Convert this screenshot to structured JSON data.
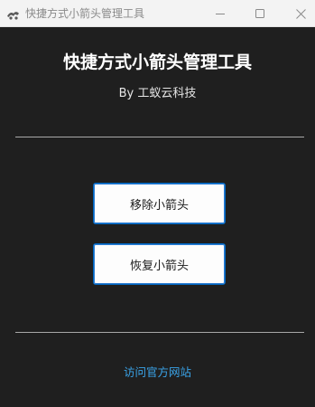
{
  "window": {
    "title": "快捷方式小箭头管理工具"
  },
  "main": {
    "heading": "快捷方式小箭头管理工具",
    "byline": "By 工蚁云科技",
    "remove_button": "移除小箭头",
    "restore_button": "恢复小箭头",
    "website_link": "访问官方网站"
  },
  "colors": {
    "background": "#1f1f1f",
    "titlebar": "#f3f3f3",
    "button_border": "#0067c0",
    "link": "#3aa3e8"
  }
}
